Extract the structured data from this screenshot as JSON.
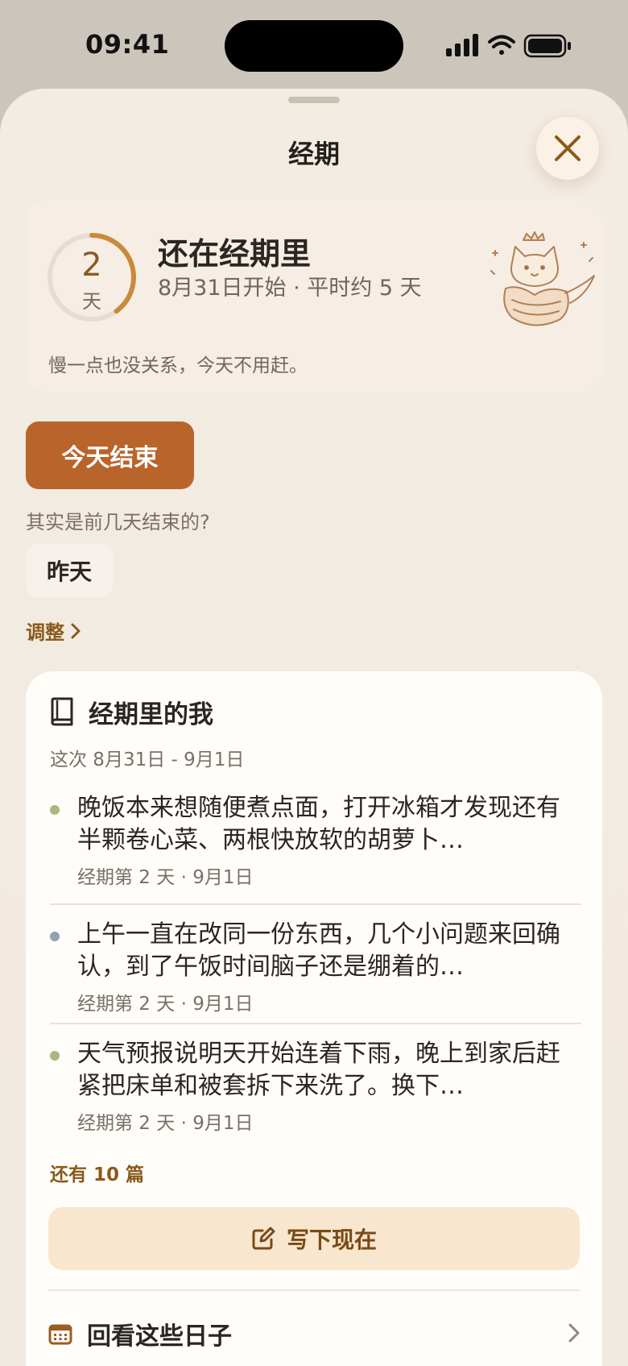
{
  "status_bar": {
    "time": "09:41"
  },
  "sheet": {
    "title": "经期",
    "close_icon": "close-icon"
  },
  "period_status": {
    "day_number": "2",
    "day_unit": "天",
    "progress": 0.4,
    "title": "还在经期里",
    "subtitle": "8月31日开始 · 平时约 5 天",
    "note": "慢一点也没关系，今天不用赶。",
    "illustration": "cat-illustration"
  },
  "actions": {
    "end_today_label": "今天结束",
    "ended_earlier_question": "其实是前几天结束的?",
    "yesterday_label": "昨天",
    "adjust_label": "调整"
  },
  "diary": {
    "icon": "book-icon",
    "title": "经期里的我",
    "range": "这次 8月31日 - 9月1日",
    "entries": [
      {
        "text": "晚饭本来想随便煮点面，打开冰箱才发现还有半颗卷心菜、两根快放软的胡萝卜…",
        "meta": "经期第 2 天 · 9月1日",
        "dot_color": "#a8b87f"
      },
      {
        "text": "上午一直在改同一份东西，几个小问题来回确认，到了午饭时间脑子还是绷着的…",
        "meta": "经期第 2 天 · 9月1日",
        "dot_color": "#8fa4ad"
      },
      {
        "text": "天气预报说明天开始连着下雨，晚上到家后赶紧把床单和被套拆下来洗了。换下…",
        "meta": "经期第 2 天 · 9月1日",
        "dot_color": "#a8b87f"
      }
    ],
    "more_label": "还有 10 篇",
    "write_label": "写下现在",
    "review_label": "回看这些日子"
  },
  "colors": {
    "accent": "#b8642a",
    "ring": "#c98a3a",
    "link": "#8a5a1c"
  }
}
